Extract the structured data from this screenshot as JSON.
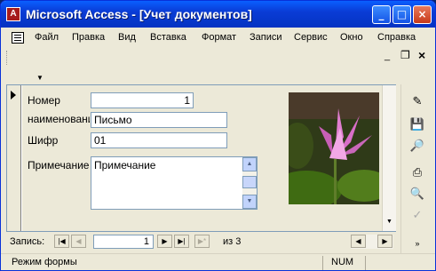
{
  "window": {
    "title": "Microsoft Access - [Учет документов]",
    "app_icon_letter": "A",
    "minimize_glyph": "_",
    "maximize_glyph": "□",
    "close_glyph": "×"
  },
  "menu": {
    "items": [
      "Файл",
      "Правка",
      "Вид",
      "Вставка",
      "Формат",
      "Записи",
      "Сервис",
      "Окно",
      "Справка"
    ],
    "doc_minimize": "_",
    "doc_restore": "❐",
    "doc_close": "×"
  },
  "form": {
    "fields": [
      {
        "label": "Номер",
        "value": "1"
      },
      {
        "label": "наименовани",
        "value": "Письмо"
      },
      {
        "label": "Шифр",
        "value": "01"
      },
      {
        "label": "Примечание",
        "value": "Примечание"
      }
    ]
  },
  "navigation": {
    "label": "Запись:",
    "current": "1",
    "of_text": "из",
    "total": "3"
  },
  "status": {
    "mode": "Режим формы",
    "num": "NUM"
  },
  "icons": {
    "right_toolbar": [
      "edit-pencil-icon",
      "save-icon",
      "search-table-icon",
      "print-icon",
      "print-preview-icon",
      "spelling-icon",
      "more-icon"
    ]
  },
  "colors": {
    "titlebar": "#0a3cd6",
    "form_background": "#ece9d8",
    "flower_petal": "#d86ec8"
  }
}
